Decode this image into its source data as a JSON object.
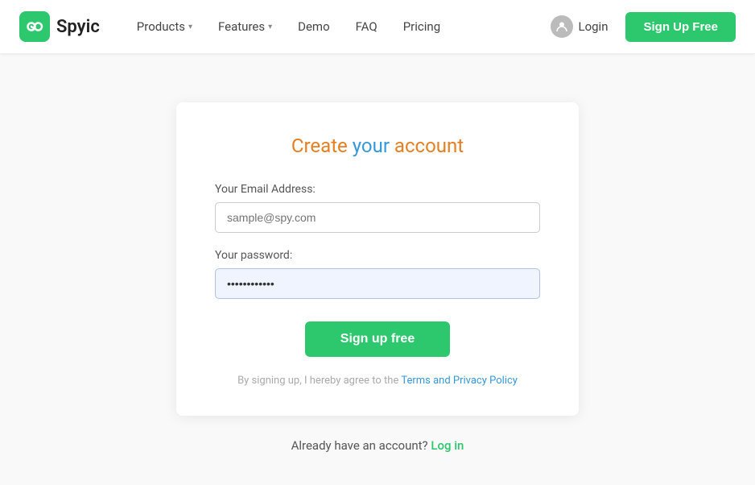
{
  "brand": {
    "name": "Spyic",
    "logo_alt": "Spyic logo"
  },
  "navbar": {
    "items": [
      {
        "id": "products",
        "label": "Products",
        "has_dropdown": true
      },
      {
        "id": "features",
        "label": "Features",
        "has_dropdown": true
      },
      {
        "id": "demo",
        "label": "Demo",
        "has_dropdown": false
      },
      {
        "id": "faq",
        "label": "FAQ",
        "has_dropdown": false
      },
      {
        "id": "pricing",
        "label": "Pricing",
        "has_dropdown": false
      }
    ],
    "login_label": "Login",
    "signup_label": "Sign Up Free"
  },
  "card": {
    "title_part1": "Create ",
    "title_part2": "your",
    "title_part3": " account",
    "email_label": "Your Email Address:",
    "email_placeholder": "sample@spy.com",
    "password_label": "Your password:",
    "password_value": "············",
    "submit_label": "Sign up free",
    "terms_text": "By signing up, I hereby agree to the ",
    "terms_link_label": "Terms and Privacy Policy"
  },
  "footer_text": {
    "prefix": "Already have an account? ",
    "link_label": "Log in"
  }
}
